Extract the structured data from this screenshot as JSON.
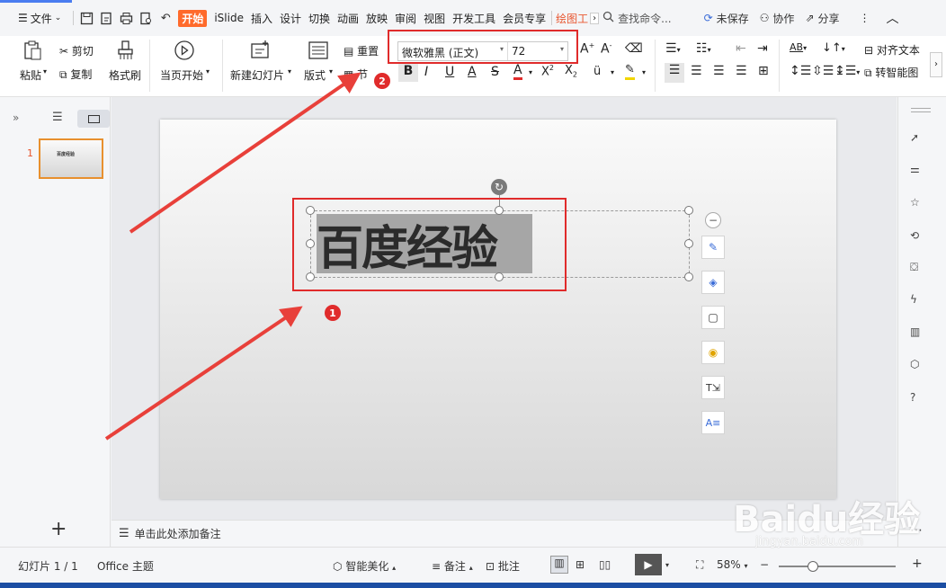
{
  "topbar": {
    "menu_label": "文件",
    "tabs": [
      "开始",
      "iSlide",
      "插入",
      "设计",
      "切换",
      "动画",
      "放映",
      "审阅",
      "视图",
      "开发工具",
      "会员专享",
      "绘图工"
    ],
    "search_placeholder": "查找命令...",
    "unsaved": "未保存",
    "collab": "协作",
    "share": "分享"
  },
  "ribbon": {
    "paste": "粘贴",
    "cut": "剪切",
    "copy": "复制",
    "format_painter": "格式刷",
    "from_current": "当页开始",
    "new_slide": "新建幻灯片",
    "layout": "版式",
    "reset": "重置",
    "section": "节",
    "font_name": "微软雅黑 (正文)",
    "font_size": "72",
    "align_text": "对齐文本",
    "smart_graphic": "转智能图"
  },
  "thumbnail": {
    "number": "1",
    "text": "百度经验"
  },
  "slide": {
    "title_text": "百度经验"
  },
  "annotations": {
    "badge1": "1",
    "badge2": "2"
  },
  "notes_placeholder": "单击此处添加备注",
  "status": {
    "slide_counter": "幻灯片 1 / 1",
    "theme": "Office 主题",
    "smart_beautify": "智能美化",
    "notes": "备注",
    "comments": "批注",
    "zoom": "58%"
  },
  "watermark": {
    "brand": "Baidu经验",
    "url": "jingyan.baidu.com"
  },
  "colors": {
    "accent": "#ff6a2b",
    "annotation_red": "#e02b2b",
    "taskbar": "#1b4ea3"
  }
}
